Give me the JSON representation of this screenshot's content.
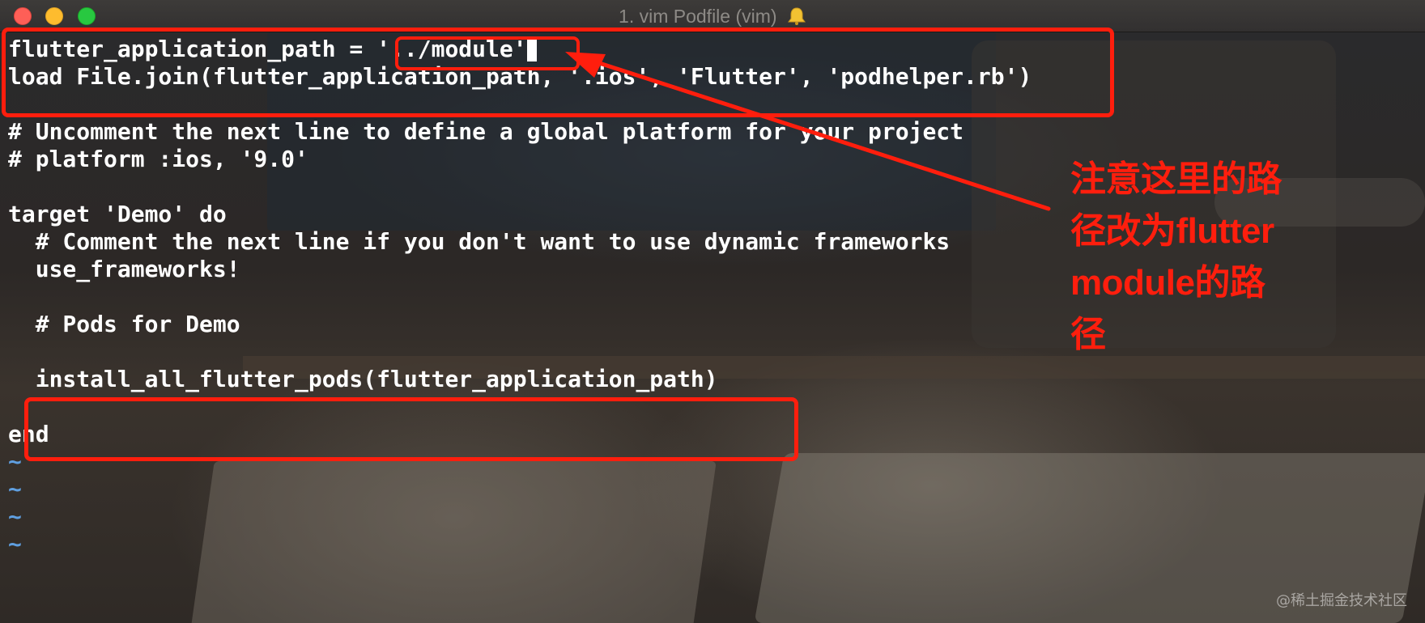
{
  "window": {
    "title": "1. vim Podfile (vim)"
  },
  "code_lines": [
    "flutter_application_path = '../module'",
    "load File.join(flutter_application_path, '.ios', 'Flutter', 'podhelper.rb')",
    "",
    "# Uncomment the next line to define a global platform for your project",
    "# platform :ios, '9.0'",
    "",
    "target 'Demo' do",
    "  # Comment the next line if you don't want to use dynamic frameworks",
    "  use_frameworks!",
    "",
    "  # Pods for Demo",
    "",
    "  install_all_flutter_pods(flutter_application_path)",
    "",
    "end",
    "~",
    "~",
    "~",
    "~"
  ],
  "annotation": {
    "text": "注意这里的路径改为flutter module的路径",
    "lines": [
      "注意这里的路",
      "径改为flutter",
      "module的路",
      "径"
    ],
    "color": "#ff1e0d"
  },
  "watermark": "@稀土掘金技术社区",
  "colors": {
    "text": "#ffffff",
    "tilde": "#5f9fe0",
    "annotation": "#ff1e0d"
  }
}
